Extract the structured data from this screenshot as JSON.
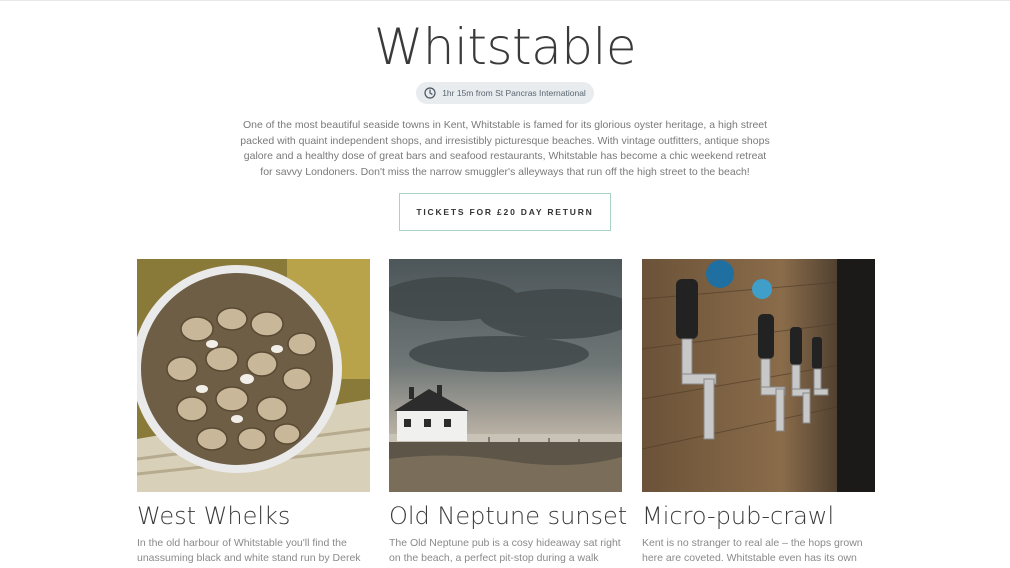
{
  "page": {
    "title": "Whitstable",
    "travel_time": "1hr 15m from St Pancras International",
    "description": "One of the most beautiful seaside towns in Kent, Whitstable is famed for its glorious oyster heritage, a high street packed with quaint independent shops, and irresistibly picturesque beaches. With vintage outfitters, antique shops galore and a healthy dose of great bars and seafood restaurants, Whitstable has become a chic weekend retreat for savvy Londoners. Don't miss the narrow smuggler's alleyways that run off the high street to the beach!",
    "cta_label": "TICKETS FOR £20 DAY RETURN"
  },
  "cards": [
    {
      "title": "West Whelks",
      "text": "In the old harbour of Whitstable you'll find the unassuming black and white stand run by Derek"
    },
    {
      "title": "Old Neptune sunset",
      "text": "The Old Neptune pub is a cosy hideaway sat right on the beach, a perfect pit-stop during a walk along"
    },
    {
      "title": "Micro-pub-crawl",
      "text": "Kent is no stranger to real ale – the hops grown here are coveted. Whitstable even has its own"
    }
  ],
  "colors": {
    "accent_border": "#a9d2c2",
    "pill_bg": "#e8ecef",
    "title": "#3a3a3a"
  },
  "icons": {
    "travel": "clock-icon"
  }
}
